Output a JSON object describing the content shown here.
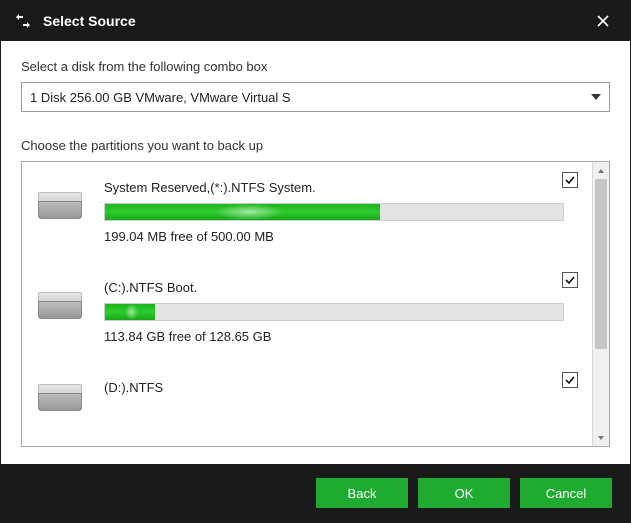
{
  "titlebar": {
    "title": "Select Source"
  },
  "labels": {
    "disk_combo": "Select a disk from the following combo box",
    "partitions": "Choose the partitions you want to back up"
  },
  "combo": {
    "selected": "1 Disk 256.00 GB VMware,  VMware Virtual S"
  },
  "partitions": [
    {
      "name": "System Reserved,(*:).NTFS System.",
      "free_text": "199.04 MB free of 500.00 MB",
      "used_pct": 60,
      "checked": true
    },
    {
      "name": "(C:).NTFS Boot.",
      "free_text": "113.84 GB free of 128.65 GB",
      "used_pct": 11,
      "checked": true
    },
    {
      "name": "(D:).NTFS",
      "free_text": "",
      "used_pct": 0,
      "checked": true
    }
  ],
  "buttons": {
    "back": "Back",
    "ok": "OK",
    "cancel": "Cancel"
  }
}
